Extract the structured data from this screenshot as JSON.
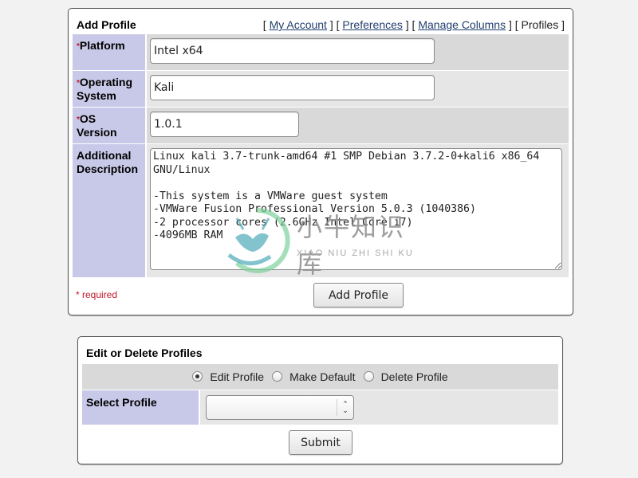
{
  "add_profile": {
    "title": "Add Profile",
    "nav": {
      "links": [
        {
          "label": "My Account",
          "active": false
        },
        {
          "label": "Preferences",
          "active": false
        },
        {
          "label": "Manage Columns",
          "active": false
        },
        {
          "label": "Profiles",
          "active": true
        }
      ]
    },
    "fields": {
      "platform": {
        "label": "Platform",
        "required_mark": "*",
        "value": "Intel x64"
      },
      "os": {
        "label_line1": "Operating",
        "label_line2": "System",
        "required_mark": "*",
        "value": "Kali"
      },
      "os_version": {
        "label_line1": "OS",
        "label_line2": "Version",
        "required_mark": "*",
        "value": "1.0.1"
      },
      "description": {
        "label_line1": "Additional",
        "label_line2": "Description",
        "value": "Linux kali 3.7-trunk-amd64 #1 SMP Debian 3.7.2-0+kali6 x86_64 GNU/Linux\n\n-This system is a VMWare guest system\n-VMWare Fusion Professional Version 5.0.3 (1040386)\n-2 processor cores (2.6GHz Intel Core i7)\n-4096MB RAM"
      }
    },
    "required_note": "* required",
    "submit_label": "Add Profile"
  },
  "edit_profiles": {
    "title": "Edit or Delete Profiles",
    "actions": [
      {
        "label": "Edit Profile",
        "checked": true
      },
      {
        "label": "Make Default",
        "checked": false
      },
      {
        "label": "Delete Profile",
        "checked": false
      }
    ],
    "select_label": "Select Profile",
    "select_value": "",
    "submit_label": "Submit"
  },
  "watermark": {
    "text_cn": "小牛知识库",
    "text_en": "XIAO NIU ZHI SHI KU"
  },
  "colors": {
    "label_bg": "#c8c8e8",
    "required": "#c0182a",
    "link": "#223e6e"
  }
}
